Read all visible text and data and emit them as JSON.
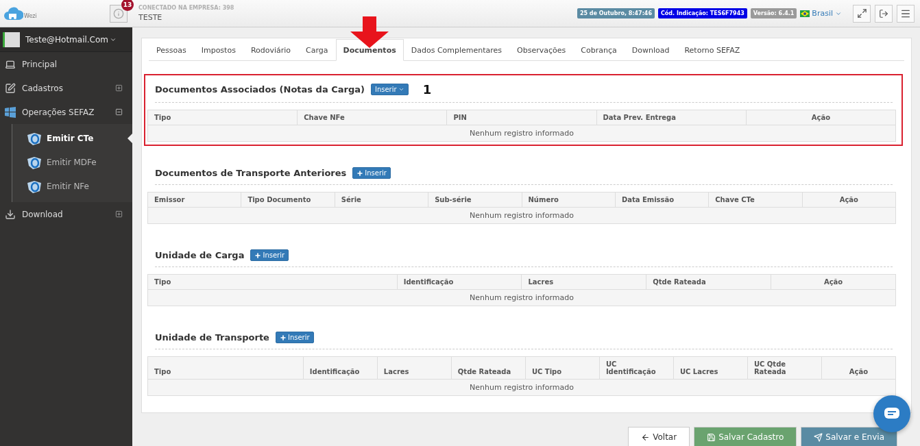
{
  "header": {
    "logo_text": "Wezi",
    "notifications": "13",
    "company_label": "CONECTADO NA EMPRESA: 398",
    "company_name": "TESTE",
    "badges": [
      {
        "text": "25 de Outubro, 8:47:46",
        "color": "#5b8ba3"
      },
      {
        "text": "Cód. Indicação: TES6F7943",
        "color": "#0000e6"
      },
      {
        "text": "Versão: 6.4.1",
        "color": "#9a9a9a"
      }
    ],
    "language": "Brasil"
  },
  "sidebar": {
    "user": "Teste@Hotmail.Com",
    "items": [
      {
        "kind": "principal",
        "label": "Principal",
        "selected": false
      },
      {
        "kind": "cadastros",
        "label": "Cadastros",
        "expanded": false,
        "selected": false
      },
      {
        "kind": "sefaz",
        "label": "Operações SEFAZ",
        "expanded": true,
        "selected": false,
        "children": [
          {
            "label": "Emitir CTe",
            "selected": true
          },
          {
            "label": "Emitir MDFe",
            "selected": false
          },
          {
            "label": "Emitir NFe",
            "selected": false
          }
        ]
      },
      {
        "kind": "download",
        "label": "Download",
        "expanded": false,
        "selected": false
      }
    ]
  },
  "tabs": [
    {
      "label": "Pessoas",
      "selected": false
    },
    {
      "label": "Impostos",
      "selected": false
    },
    {
      "label": "Rodoviário",
      "selected": false
    },
    {
      "label": "Carga",
      "selected": false
    },
    {
      "label": "Documentos",
      "selected": true
    },
    {
      "label": "Dados Complementares",
      "selected": false
    },
    {
      "label": "Observações",
      "selected": false
    },
    {
      "label": "Cobrança",
      "selected": false
    },
    {
      "label": "Download",
      "selected": false
    },
    {
      "label": "Retorno SEFAZ",
      "selected": false
    }
  ],
  "sections": [
    {
      "title": "Documentos Associados (Notas da Carga)",
      "button": {
        "label": "Inserir",
        "kind": "dropdown"
      },
      "highlighted": true,
      "annotation": "1",
      "columns": [
        "Tipo",
        "Chave NFe",
        "PIN",
        "Data Prev. Entrega",
        "Ação"
      ],
      "empty_message": "Nenhum registro informado"
    },
    {
      "title": "Documentos de Transporte Anteriores",
      "button": {
        "label": "Inserir",
        "kind": "add"
      },
      "highlighted": false,
      "columns": [
        "Emissor",
        "Tipo Documento",
        "Série",
        "Sub-série",
        "Número",
        "Data Emissão",
        "Chave CTe",
        "Ação"
      ],
      "empty_message": "Nenhum registro informado"
    },
    {
      "title": "Unidade de Carga",
      "button": {
        "label": "Inserir",
        "kind": "add"
      },
      "highlighted": false,
      "columns": [
        "Tipo",
        "Identificação",
        "Lacres",
        "Qtde Rateada",
        "Ação"
      ],
      "empty_message": "Nenhum registro informado"
    },
    {
      "title": "Unidade de Transporte",
      "button": {
        "label": "Inserir",
        "kind": "add"
      },
      "highlighted": false,
      "columns": [
        "Tipo",
        "Identificação",
        "Lacres",
        "Qtde Rateada",
        "UC Tipo",
        "UC Identificação",
        "UC Lacres",
        "UC Qtde Rateada",
        "Ação"
      ],
      "empty_message": "Nenhum registro informado"
    }
  ],
  "footer_buttons": [
    {
      "label": "Voltar",
      "kind": "back"
    },
    {
      "label": "Salvar Cadastro",
      "kind": "save"
    },
    {
      "label": "Salvar e Envia",
      "kind": "send"
    }
  ]
}
